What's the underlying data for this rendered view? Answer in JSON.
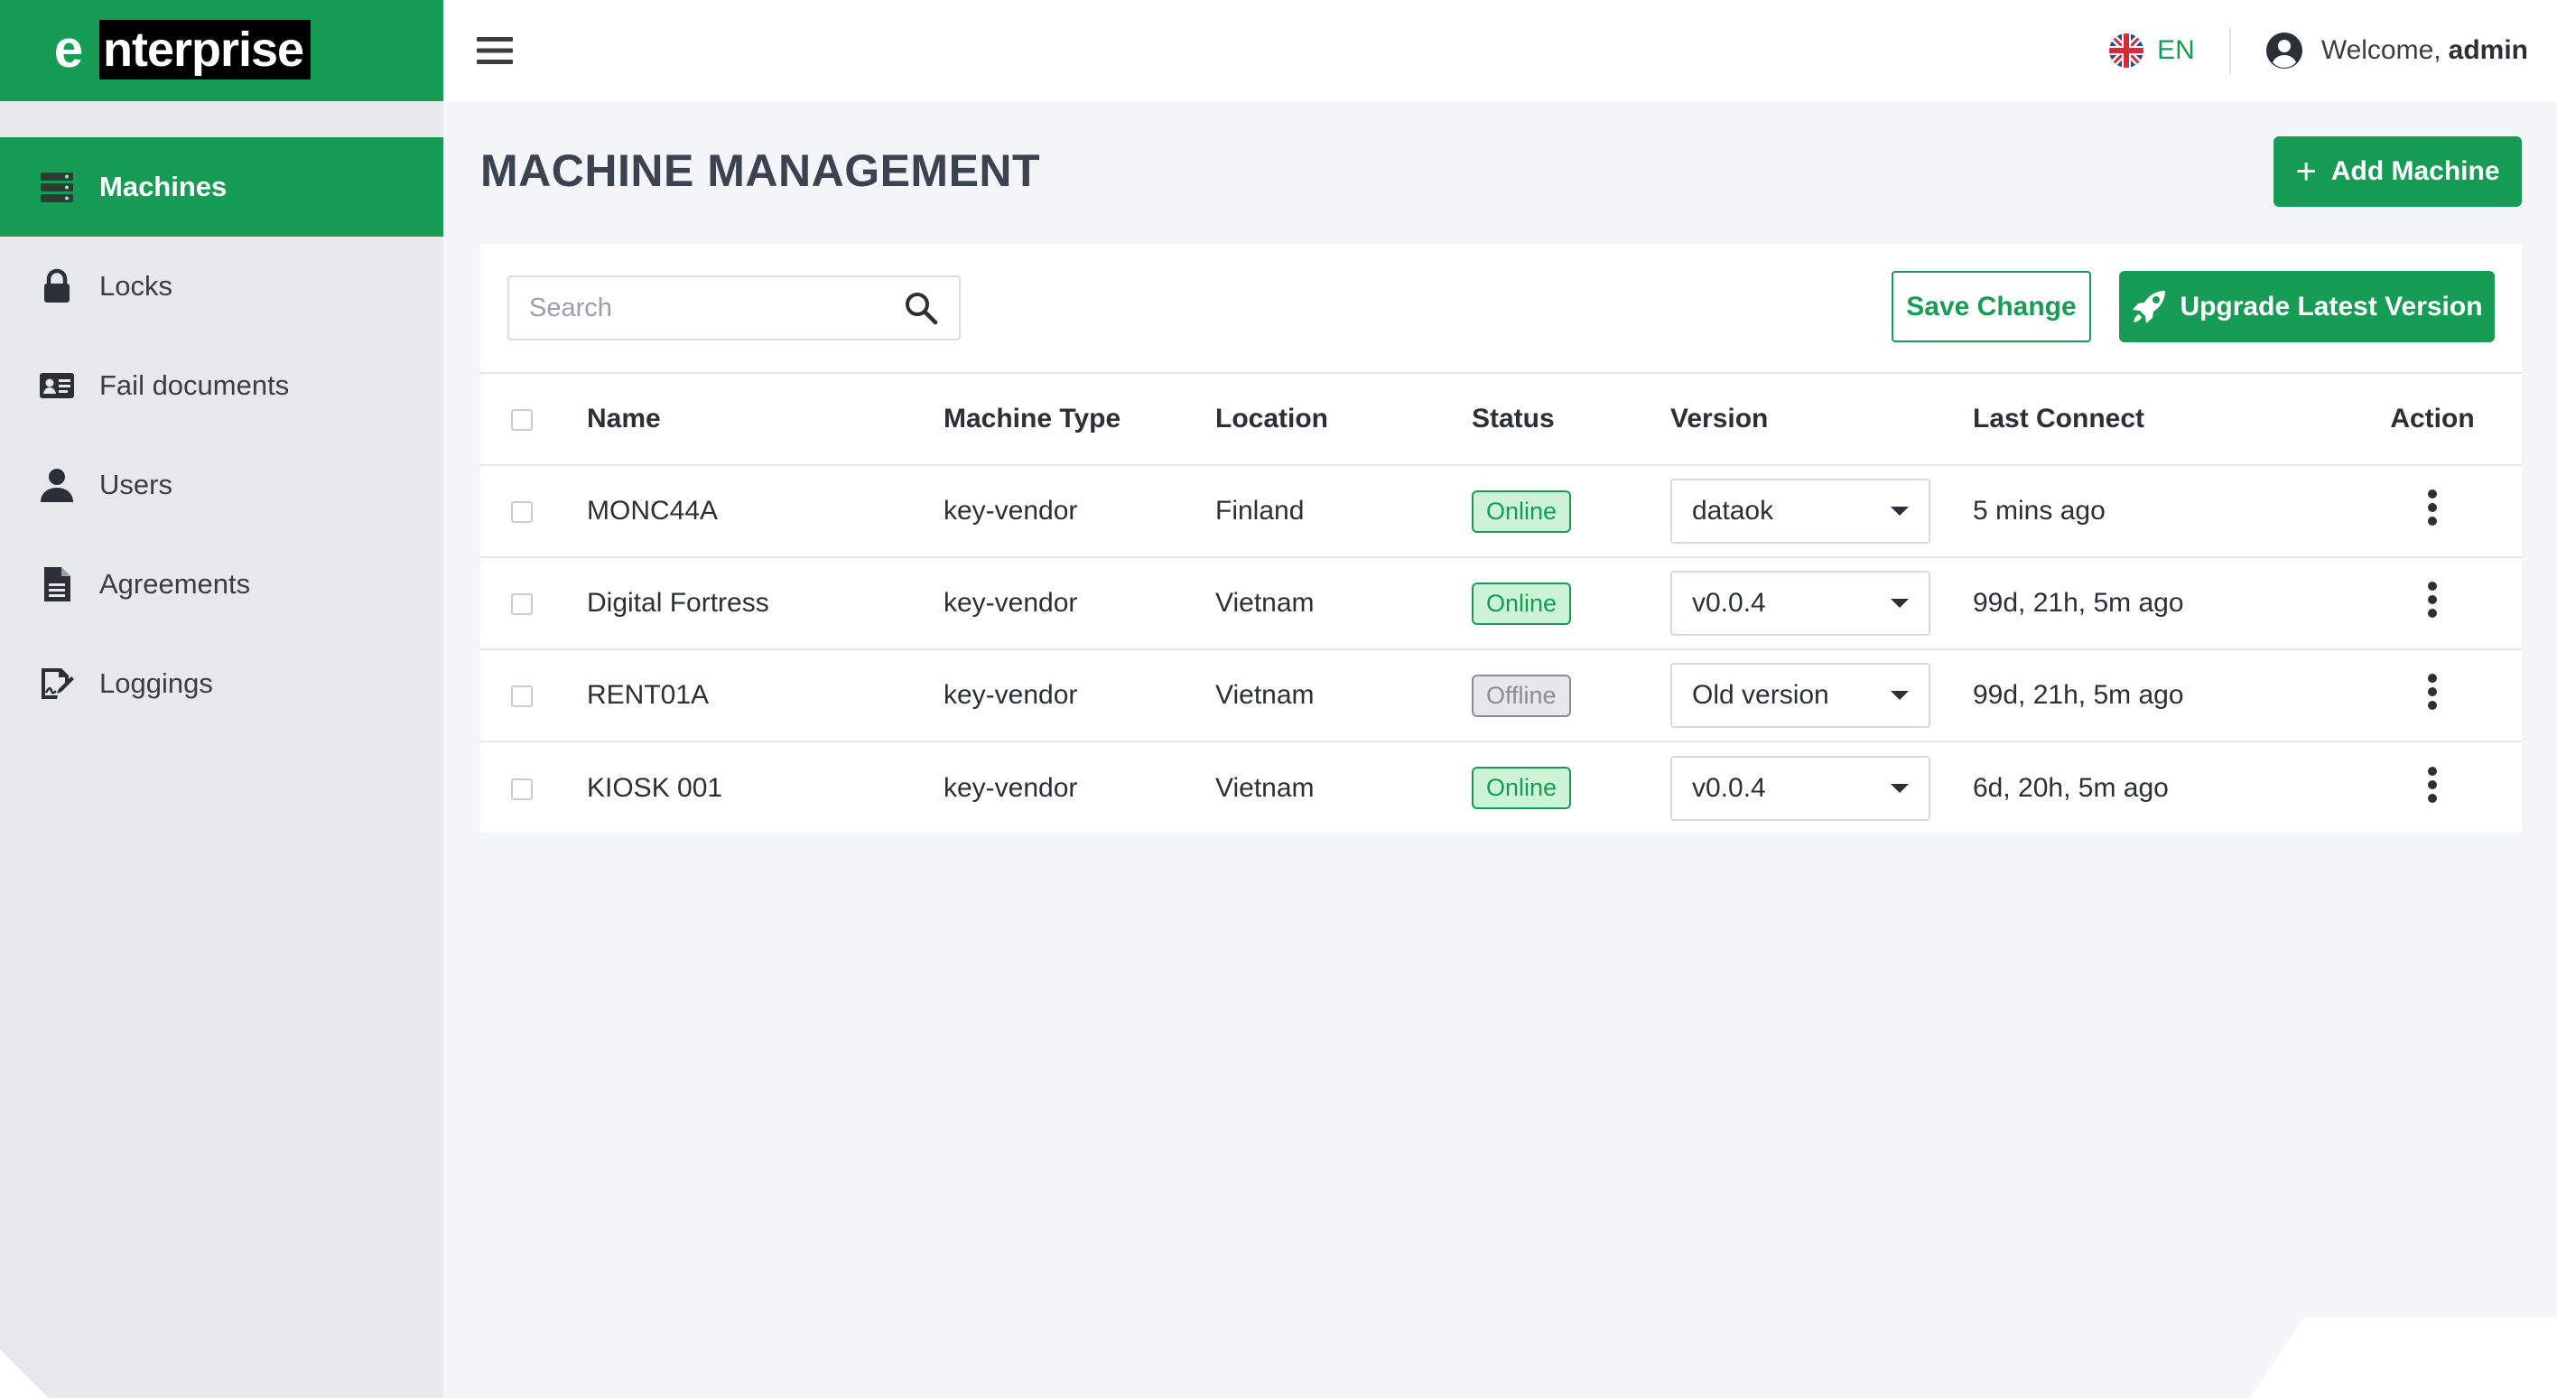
{
  "brand": {
    "logo_e": "e",
    "logo_rest": "nterprise",
    "color": "#169c55"
  },
  "sidebar": {
    "items": [
      {
        "label": "Machines",
        "icon": "server-icon",
        "active": true
      },
      {
        "label": "Locks",
        "icon": "lock-icon",
        "active": false
      },
      {
        "label": "Fail documents",
        "icon": "id-card-icon",
        "active": false
      },
      {
        "label": "Users",
        "icon": "user-icon",
        "active": false
      },
      {
        "label": "Agreements",
        "icon": "file-text-icon",
        "active": false
      },
      {
        "label": "Loggings",
        "icon": "signature-icon",
        "active": false
      }
    ]
  },
  "header": {
    "menu_icon": "hamburger-icon",
    "language": "EN",
    "language_icon": "uk-flag-icon",
    "welcome": "Welcome,",
    "username": "admin",
    "user_icon": "user-circle-icon"
  },
  "page": {
    "title": "MACHINE MANAGEMENT",
    "add_button": "Add Machine"
  },
  "toolbar": {
    "search_placeholder": "Search",
    "save_label": "Save Change",
    "upgrade_label": "Upgrade Latest Version"
  },
  "table": {
    "columns": [
      "Name",
      "Machine Type",
      "Location",
      "Status",
      "Version",
      "Last Connect",
      "Action"
    ],
    "rows": [
      {
        "name": "MONC44A",
        "type": "key-vendor",
        "location": "Finland",
        "status": "Online",
        "version": "dataok",
        "last": "5 mins ago"
      },
      {
        "name": "Digital Fortress",
        "type": "key-vendor",
        "location": "Vietnam",
        "status": "Online",
        "version": "v0.0.4",
        "last": "99d, 21h, 5m ago"
      },
      {
        "name": "RENT01A",
        "type": "key-vendor",
        "location": "Vietnam",
        "status": "Offline",
        "version": "Old version",
        "last": "99d, 21h, 5m ago"
      },
      {
        "name": "KIOSK 001",
        "type": "key-vendor",
        "location": "Vietnam",
        "status": "Online",
        "version": "v0.0.4",
        "last": "6d, 20h, 5m ago"
      }
    ]
  }
}
